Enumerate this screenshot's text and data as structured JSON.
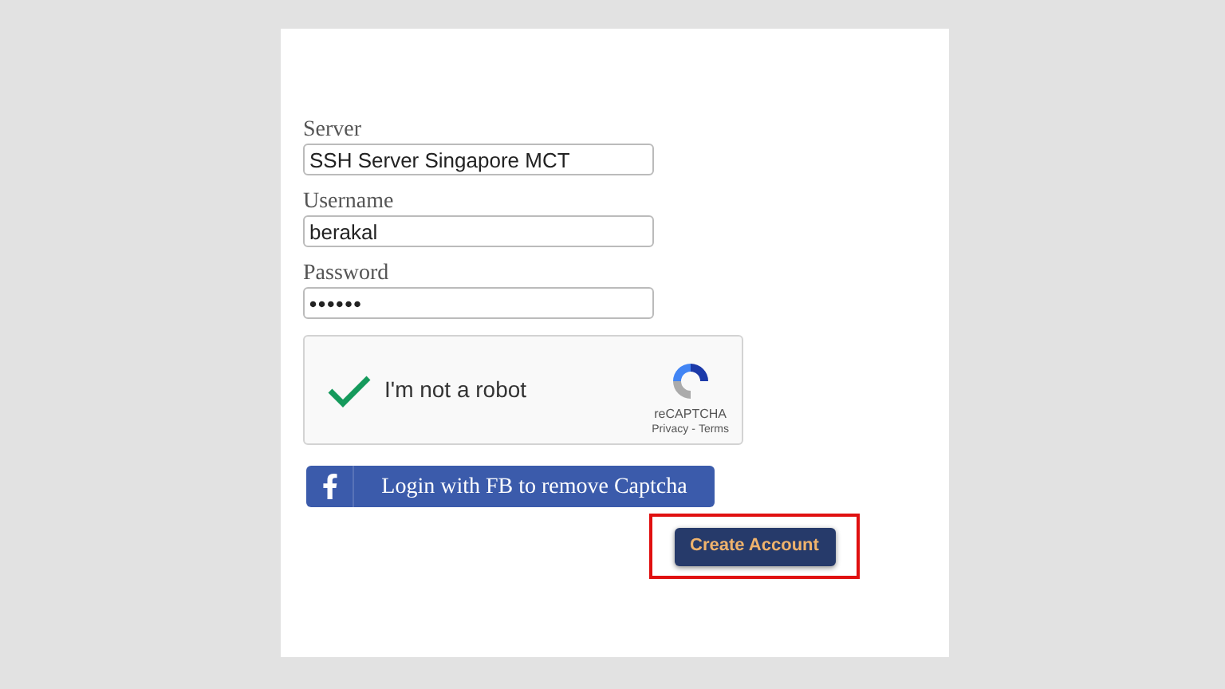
{
  "fields": [
    {
      "label": "Server",
      "value": "SSH Server Singapore MCT",
      "kind": "text"
    },
    {
      "label": "Username",
      "value": "berakal",
      "kind": "text"
    },
    {
      "label": "Password",
      "value": "••••••",
      "kind": "password"
    }
  ],
  "captcha": {
    "checked": true,
    "label": "I'm not a robot",
    "brand": "reCAPTCHA",
    "privacy": "Privacy",
    "separator": "-",
    "terms": "Terms"
  },
  "facebook_button": {
    "label": "Login with FB to remove Captcha"
  },
  "create_button": {
    "label": "Create Account",
    "highlighted": true
  }
}
